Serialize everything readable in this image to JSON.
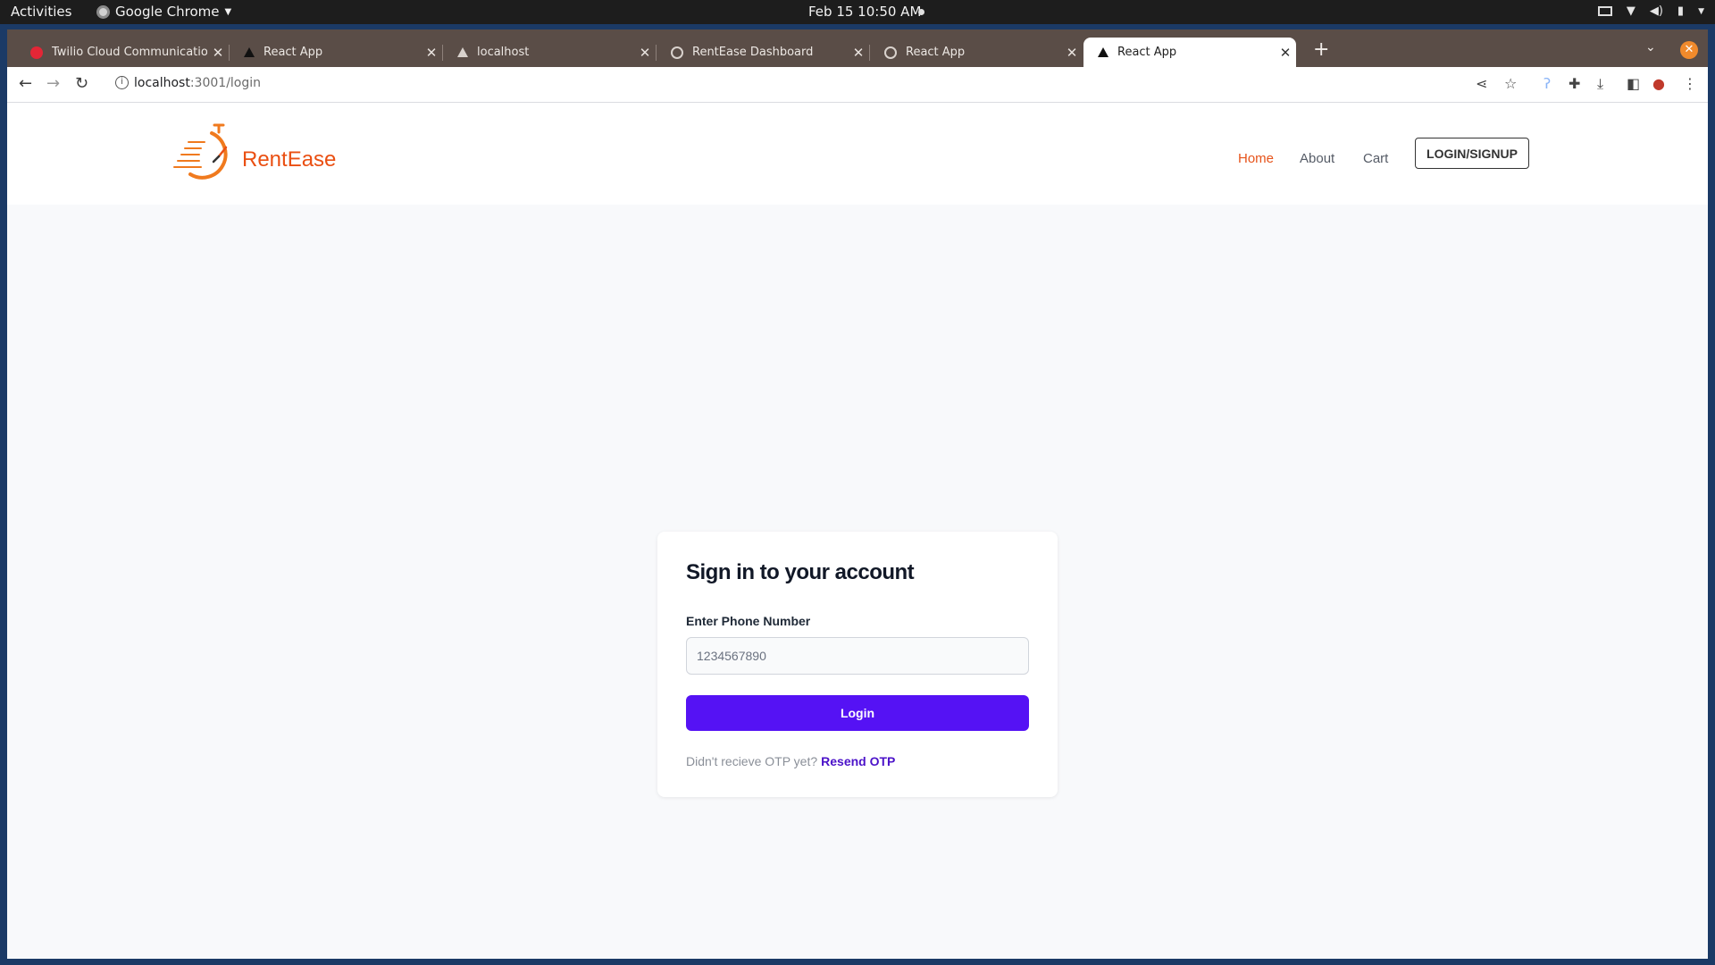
{
  "os": {
    "activities": "Activities",
    "app_name": "Google Chrome",
    "clock": "Feb 15  10:50 AM"
  },
  "browser": {
    "tabs": [
      {
        "title": "Twilio Cloud Communications",
        "favicon": "twilio-icon",
        "active": false
      },
      {
        "title": "React App",
        "favicon": "triangle-icon",
        "active": false
      },
      {
        "title": "localhost",
        "favicon": "triangle-icon",
        "active": false
      },
      {
        "title": "RentEase Dashboard",
        "favicon": "globe-icon",
        "active": false
      },
      {
        "title": "React App",
        "favicon": "globe-icon",
        "active": false
      },
      {
        "title": "React App",
        "favicon": "triangle-icon",
        "active": true
      }
    ],
    "url_host": "localhost",
    "url_rest": ":3001/login"
  },
  "site": {
    "brand": "RentEase",
    "nav": {
      "home": "Home",
      "about": "About",
      "cart": "Cart",
      "login_signup": "LOGIN/SIGNUP"
    },
    "colors": {
      "brand_orange": "#ea4f12",
      "primary_button": "#5512f4",
      "link": "#4b12c9"
    }
  },
  "login": {
    "title": "Sign in to your account",
    "phone_label": "Enter Phone Number",
    "phone_placeholder": "1234567890",
    "phone_value": "",
    "button": "Login",
    "otp_prompt": "Didn't recieve OTP yet?",
    "resend": "Resend OTP"
  }
}
